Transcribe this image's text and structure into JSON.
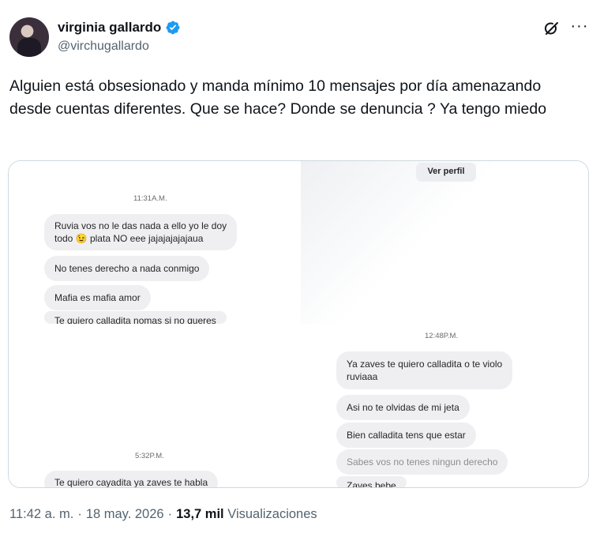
{
  "author": {
    "display_name": "virginia gallardo",
    "handle": "@virchugallardo",
    "verified": true,
    "verified_color": "#1d9bf0"
  },
  "header_icons": [
    "grok-icon",
    "more-options-icon"
  ],
  "tweet": {
    "text": "Alguien está obsesionado y manda mínimo 10 mensajes por día amenazando desde cuentas diferentes. Que se hace? Donde se denuncia ? Ya tengo miedo"
  },
  "media": {
    "panel_a": {
      "timestamp": "11:31A.M.",
      "messages": [
        "Ruvia vos no le das nada a ello yo le doy",
        "todo 😉 plata NO eee jajajajajajaua",
        "No tenes derecho a nada conmigo",
        "Mafia es mafia amor",
        "Te quiero calladita nomas si no queres"
      ]
    },
    "panel_b": {
      "view_profile": "Ver perfil"
    },
    "panel_c": {
      "timestamp_left": "5:32P.M.",
      "left_message": "Te quiero cayadita ya zaves te habla",
      "timestamp_right": "12:48P.M.",
      "right_messages": [
        "Ya zaves te quiero calladita o te violo",
        "ruviaaa",
        "Asi no te olvidas de mi jeta",
        "Bien calladita tens que estar",
        "Sabes vos no tenes ningun derecho",
        "Zaves bebe"
      ]
    }
  },
  "meta": {
    "time": "11:42 a. m.",
    "separator": "·",
    "date": "18 may. 2026",
    "views_count": "13,7 mil",
    "views_label": "Visualizaciones"
  }
}
